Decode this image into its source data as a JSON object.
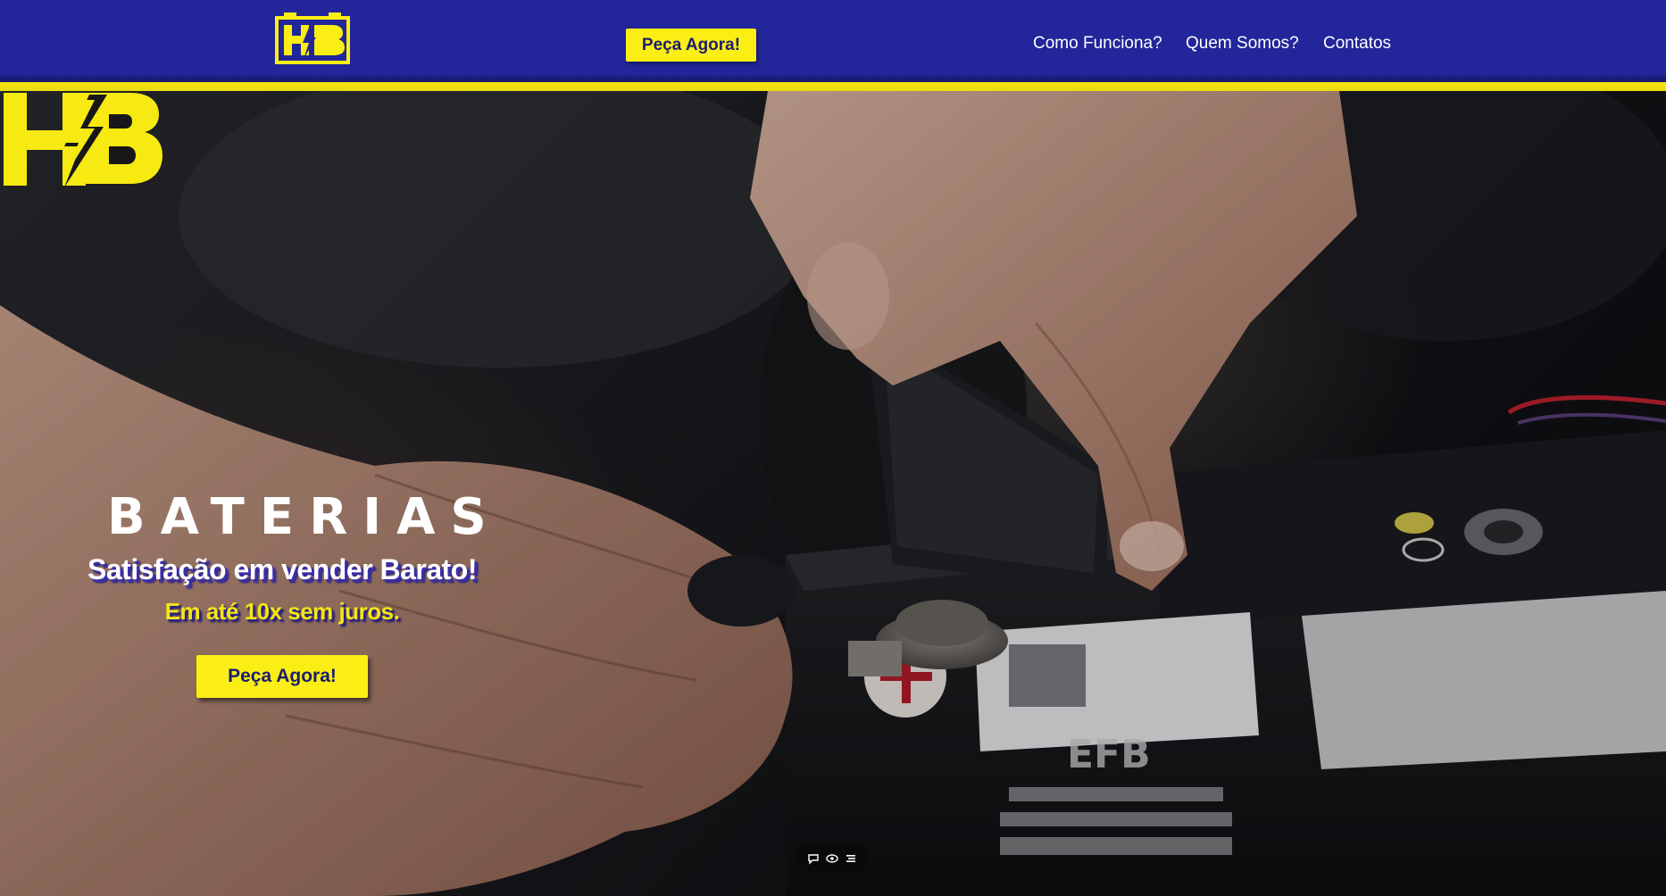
{
  "header": {
    "logo_icon": "hb-logo-icon",
    "cta_label": "Peça Agora!",
    "nav": [
      {
        "label": "Como Funciona?"
      },
      {
        "label": "Quem Somos?"
      },
      {
        "label": "Contatos"
      }
    ]
  },
  "hero": {
    "brand": "BATERIAS",
    "tagline": "Satisfação em vender Barato!",
    "subtitle": "Em até 10x sem juros.",
    "cta_label": "Peça Agora!"
  },
  "toolbar": {
    "icons": [
      "comment-icon",
      "eye-icon",
      "menu-icon"
    ]
  },
  "colors": {
    "header_bg": "#22269a",
    "accent_yellow": "#fbee14",
    "button_text": "#1b1d6e"
  }
}
